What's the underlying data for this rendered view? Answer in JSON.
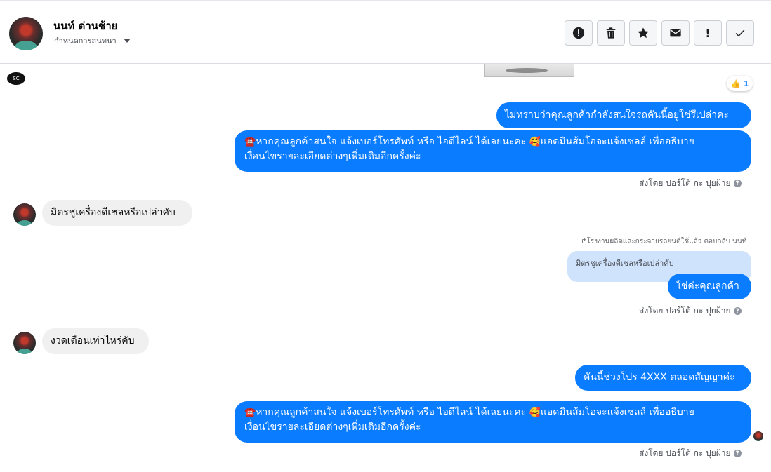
{
  "header": {
    "contact_name": "นนท์ ด่านช้าย",
    "conversation_settings": "กำหนดการสนทนา",
    "toolbar": [
      {
        "icon": "alert-icon"
      },
      {
        "icon": "trash-icon"
      },
      {
        "icon": "star-icon"
      },
      {
        "icon": "mail-icon"
      },
      {
        "icon": "exclamation-icon",
        "label": "!"
      },
      {
        "icon": "check-icon"
      }
    ]
  },
  "page_logo": "SC",
  "reaction": {
    "emoji": "👍",
    "count": "1"
  },
  "messages": {
    "m1": "ไม่ทราบว่าคุณลูกค้ากำลังสนใจรถคันนี้อยู่ใช่รึเปล่าคะ",
    "m2": {
      "icon": "☎️",
      "line1a": "หากคุณลูกค้าสนใจ แจ้งเบอร์โทรศัพท์ หรือ ไอดีไลน์  ได้เลยนะคะ ",
      "emoji": "🥰",
      "line1b": "แอดมินส้มโอจะแจ้งเซลล์   เพื่ออธิบาย",
      "line2": "เงื่อนไขรายละเอียดต่างๆเพิ่มเติมอีกครั้งค่ะ"
    },
    "sent_by_1": "ส่งโดย ปอร์โต้ กะ ปุยฝ้าย",
    "m3": "มิตรชูเครื่องดีเชลหรือเปล่าคับ",
    "reply_note": "↱โรงงานผลิตและกระจายรถยนต์ใช้แล้ว ตอบกลับ นนท์",
    "reply_quote": "มิตรชูเครื่องดีเชลหรือเปล่าคับ",
    "m4": "ใช่ค่ะคุณลูกค้า",
    "sent_by_2": "ส่งโดย ปอร์โต้ กะ ปุยฝ้าย",
    "m5": "งวดเดือนเท่าไหร่คับ",
    "m6": "คันนี้ช่วงโปร 4XXX ตลอดสัญญาค่ะ",
    "m7": {
      "icon": "☎️",
      "line1a": "หากคุณลูกค้าสนใจ แจ้งเบอร์โทรศัพท์ หรือ ไอดีไลน์  ได้เลยนะคะ ",
      "emoji": "🥰",
      "line1b": "แอดมินส้มโอจะแจ้งเซลล์   เพื่ออธิบาย",
      "line2": "เงื่อนไขรายละเอียดต่างๆเพิ่มเติมอีกครั้งค่ะ"
    },
    "sent_by_3": "ส่งโดย ปอร์โต้ กะ ปุยฝ้าย",
    "help_glyph": "?"
  },
  "colors": {
    "outgoing_bubble": "#0a7cff",
    "incoming_bubble": "#f0f0f0",
    "reply_quote": "#cfe3fc"
  }
}
